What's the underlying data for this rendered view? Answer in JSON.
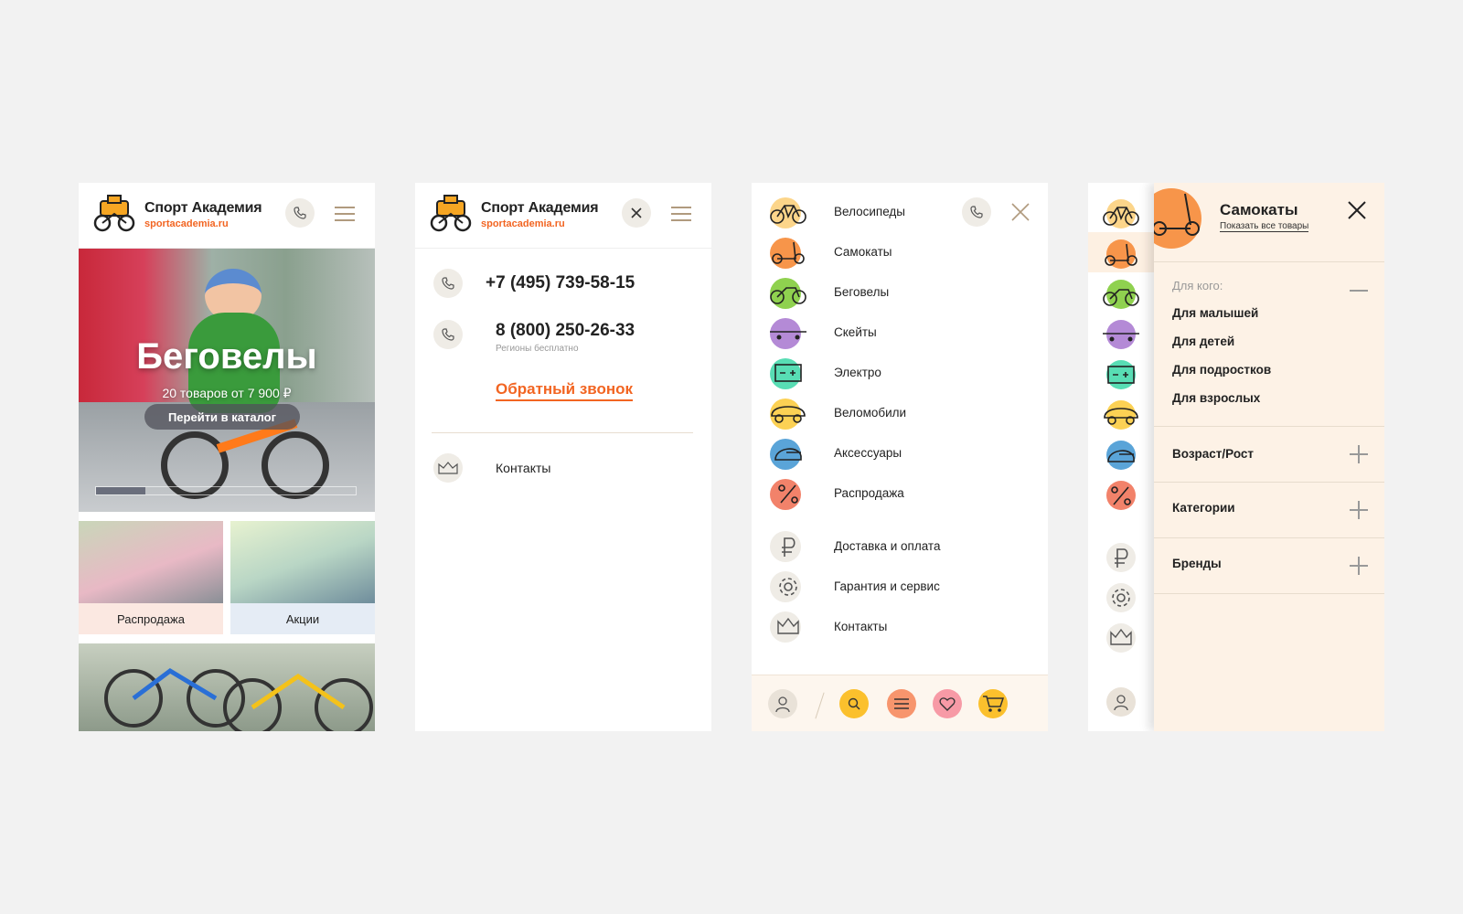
{
  "brand": {
    "name": "Спорт Академия",
    "url": "sportacademia.ru"
  },
  "screen1": {
    "hero": {
      "title": "Беговелы",
      "subtitle": "20 товаров от 7 900 ₽",
      "button": "Перейти в каталог"
    },
    "tiles": [
      {
        "label": "Распродажа"
      },
      {
        "label": "Акции"
      }
    ]
  },
  "screen2": {
    "phone1": "+7 (495) 739-58-15",
    "phone2": "8 (800) 250-26-33",
    "phone2_note": "Регионы бесплатно",
    "callback": "Обратный звонок",
    "contacts": "Контакты"
  },
  "screen3": {
    "categories": [
      {
        "label": "Велосипеды",
        "icon": "bicycle-icon",
        "color": "#fcd58a"
      },
      {
        "label": "Самокаты",
        "icon": "scooter-icon",
        "color": "#f7954a"
      },
      {
        "label": "Беговелы",
        "icon": "balance-bike-icon",
        "color": "#8fd14f"
      },
      {
        "label": "Скейты",
        "icon": "skateboard-icon",
        "color": "#b48ad6"
      },
      {
        "label": "Электро",
        "icon": "battery-icon",
        "color": "#58ddb4"
      },
      {
        "label": "Веломобили",
        "icon": "pedal-car-icon",
        "color": "#fcd154"
      },
      {
        "label": "Аксессуары",
        "icon": "helmet-icon",
        "color": "#5aa4d8"
      },
      {
        "label": "Распродажа",
        "icon": "percent-icon",
        "color": "#f2826a"
      }
    ],
    "info": [
      {
        "label": "Доставка и оплата",
        "icon": "ruble-icon"
      },
      {
        "label": "Гарантия и сервис",
        "icon": "gear-icon"
      },
      {
        "label": "Контакты",
        "icon": "crown-icon"
      }
    ],
    "bottom_bar": [
      {
        "icon": "user-icon",
        "color": "#e9e2d8"
      },
      {
        "icon": "search-icon",
        "color": "#fbc02d"
      },
      {
        "icon": "compare-list-icon",
        "color": "#f7956d"
      },
      {
        "icon": "heart-icon",
        "color": "#f79aa6"
      },
      {
        "icon": "cart-icon",
        "color": "#fbc02d"
      }
    ]
  },
  "screen4": {
    "title": "Самокаты",
    "show_all": "Показать все товары",
    "for_whom": {
      "label": "Для кого:",
      "options": [
        "Для малышей",
        "Для детей",
        "Для подростков",
        "Для взрослых"
      ]
    },
    "filters": [
      "Возраст/Рост",
      "Категории",
      "Бренды"
    ]
  },
  "colors": {
    "accent": "#f26522",
    "panel_bg": "#fdf2e6",
    "icon_bg": "#efece6"
  }
}
